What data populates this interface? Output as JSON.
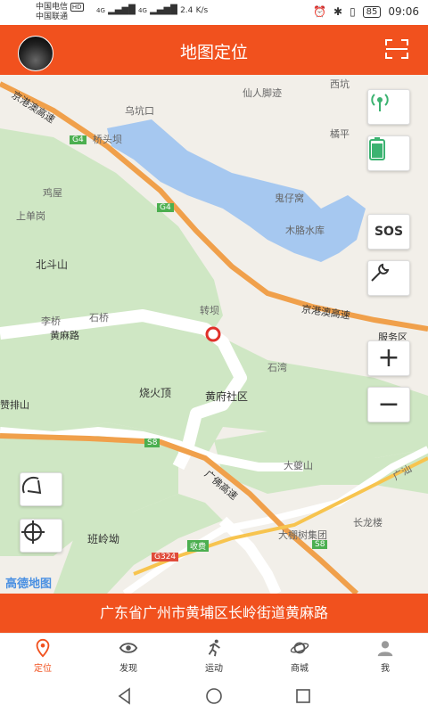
{
  "status_bar": {
    "carrier1": "中国电信",
    "carrier2": "中国联通",
    "hd": "HD",
    "net1": "4G",
    "net2": "4G",
    "speed": "2.4",
    "speed_unit": "K/s",
    "battery": "85",
    "time": "09:06"
  },
  "header": {
    "title": "地图定位"
  },
  "map": {
    "provider": "高德地图",
    "labels": {
      "xiankun": "西坑",
      "xianren": "仙人脚迹",
      "wukengkou": "乌坑口",
      "qiaotouba": "桥头坝",
      "heping": "橘平",
      "jiuxiang": "鸡屋",
      "shangyu": "上单岗",
      "guizigang": "鬼仔窝",
      "muge": "木胳水库",
      "beidou": "北斗山",
      "g4a": "G4",
      "g4b": "G4",
      "jinggang_top": "京港澳高速",
      "jinggang_right": "京港澳高速",
      "zhuanzhou": "转坝",
      "liqiao": "李桥",
      "shiqiao": "石桥",
      "huangma_rd": "黄麻路",
      "service": "服务区",
      "shiwan": "石湾",
      "chenhuo": "烧火顶",
      "huangfu": "黄府社区",
      "zanpai": "赞排山",
      "s8a": "S8",
      "s8b": "S8",
      "guangshen": "广佛高速",
      "dajiang": "大夔山",
      "guangshan": "广汕",
      "changlong": "长龙楼",
      "banling": "班岭坳",
      "dageng": "大棚树集团",
      "g324": "G324",
      "shoufei": "收费"
    }
  },
  "side_buttons": {
    "sos": "SOS"
  },
  "address": "广东省广州市黄埔区长岭街道黄麻路",
  "tabs": [
    {
      "label": "定位",
      "icon": "location-icon"
    },
    {
      "label": "发现",
      "icon": "eye-icon"
    },
    {
      "label": "运动",
      "icon": "runner-icon"
    },
    {
      "label": "商城",
      "icon": "planet-icon"
    },
    {
      "label": "我",
      "icon": "user-icon"
    }
  ],
  "colors": {
    "accent": "#f1511e",
    "water": "#a6c8f0",
    "green": "#cfe7c4",
    "highway": "#f0a04b"
  }
}
